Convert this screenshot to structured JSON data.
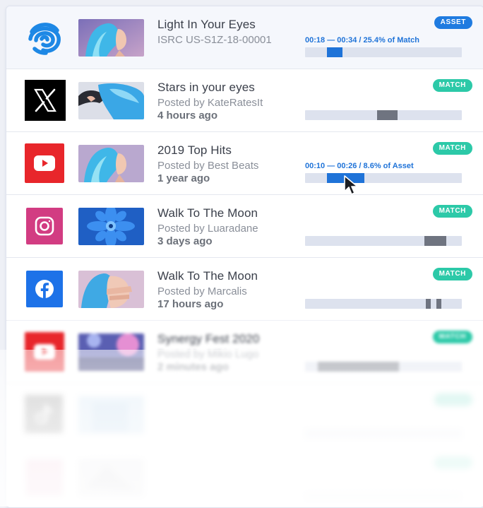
{
  "rows": [
    {
      "platform_icon": "fingerprint-icon",
      "thumbnail": "blue-hair-woman-profile-thumbnail",
      "title": "Light In Your Eyes",
      "subtitle": "ISRC US-S1Z-18-00001",
      "time": "",
      "badge": "ASSET",
      "segment_label": "00:18 — 00:34 / 25.4% of Match",
      "segments": [
        [
          0.14,
          0.24
        ]
      ]
    },
    {
      "platform_icon": "x-logo-icon",
      "thumbnail": "blue-hair-woman-leaning-thumbnail",
      "title": "Stars in your eyes",
      "subtitle": "Posted by KateRatesIt",
      "time": "4 hours ago",
      "badge": "MATCH",
      "segment_label": "",
      "segments": [
        [
          0.46,
          0.59
        ]
      ]
    },
    {
      "platform_icon": "youtube-icon",
      "thumbnail": "blue-hair-woman-profile-thumbnail",
      "title": "2019 Top Hits",
      "subtitle": "Posted by Best Beats",
      "time": "1 year ago",
      "badge": "MATCH",
      "segment_label": "00:10 — 00:26 / 8.6% of Asset",
      "segments": [
        [
          0.14,
          0.38
        ]
      ]
    },
    {
      "platform_icon": "instagram-icon",
      "thumbnail": "blue-flower-thumbnail",
      "title": "Walk To The Moon",
      "subtitle": "Posted by Luaradane",
      "time": "3 days ago",
      "badge": "MATCH",
      "segment_label": "",
      "segments": [
        [
          0.76,
          0.9
        ]
      ]
    },
    {
      "platform_icon": "facebook-icon",
      "thumbnail": "blue-hair-woman-hands-face-thumbnail",
      "title": "Walk To The Moon",
      "subtitle": "Posted by Marcalis",
      "time": "17 hours ago",
      "badge": "MATCH",
      "segment_label": "",
      "segments": [
        [
          0.77,
          0.8
        ],
        [
          0.84,
          0.87
        ]
      ]
    },
    {
      "platform_icon": "youtube-icon",
      "thumbnail": "concert-lights-thumbnail",
      "title": "Synergy Fest 2020",
      "subtitle": "Posted by Mikio Lugo",
      "time": "2 minutes ago",
      "badge": "MATCH",
      "segment_label": "",
      "segments": [
        [
          0.08,
          0.6
        ]
      ]
    }
  ],
  "colors": {
    "asset_badge": "#1f7be0",
    "match_badge": "#2cc9a8",
    "segment_active": "#1f73d8",
    "segment_inactive": "#6f7480",
    "track": "#dde2ee"
  }
}
